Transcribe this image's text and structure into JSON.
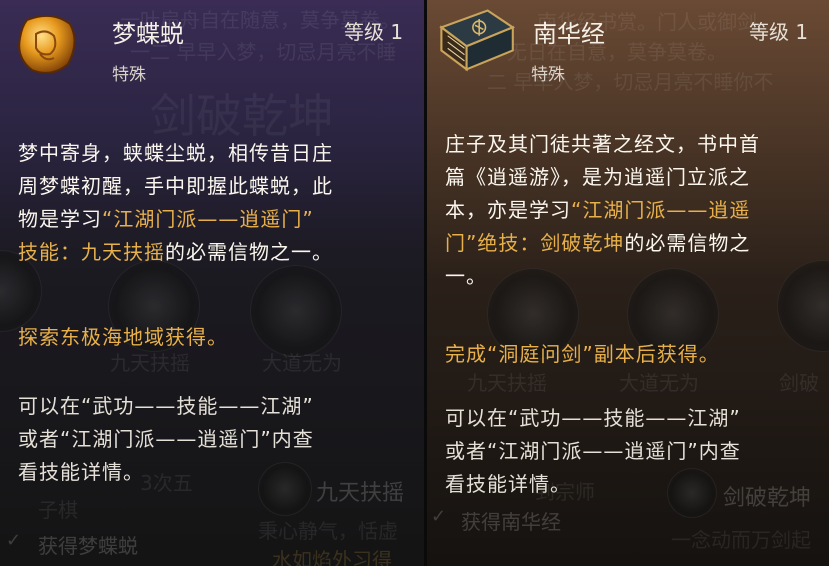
{
  "left": {
    "title": "梦蝶蜕",
    "level": "等级 1",
    "category": "特殊",
    "desc_lines": [
      [
        {
          "t": "梦中寄身，蛱蝶尘蜕，相传昔日庄"
        }
      ],
      [
        {
          "t": "周梦蝶初醒，手中即握此蝶蜕，此"
        }
      ],
      [
        {
          "t": "物是学习"
        },
        {
          "t": "“江湖门派——逍遥门”",
          "h": true
        }
      ],
      [
        {
          "t": "技能：九天扶摇",
          "h": true
        },
        {
          "t": "的必需信物之一。"
        }
      ]
    ],
    "source": "探索东极海地域获得。",
    "hint_lines": [
      "可以在“武功——技能——江湖”",
      "或者“江湖门派——逍遥门”内查",
      "看技能详情。"
    ],
    "bg": {
      "top_text": "一叶扁舟自在随意，莫争莫卷。",
      "top_text2": "一二 早早入梦，切忌月亮不睡",
      "skill1": "九天扶摇",
      "skill2": "大道无为",
      "skill3": "九天扶摇",
      "skill_desc": "秉心静气，恬虚",
      "skill_desc2": "水如焰外习得",
      "check_label": "获得梦蝶蜕",
      "left_note": "3次五",
      "left_note2": "子棋",
      "big": "剑破乾坤"
    }
  },
  "right": {
    "title": "南华经",
    "level": "等级 1",
    "category": "特殊",
    "desc_lines": [
      [
        {
          "t": "庄子及其门徒共著之经文，书中首"
        }
      ],
      [
        {
          "t": "篇《逍遥游》，是为逍遥门立派之"
        }
      ],
      [
        {
          "t": "本，亦是学习"
        },
        {
          "t": "“江湖门派——逍遥",
          "h": true
        }
      ],
      [
        {
          "t": "门”绝技：剑破乾坤",
          "h": true
        },
        {
          "t": "的必需信物之"
        }
      ],
      [
        {
          "t": "一。"
        }
      ]
    ],
    "source": "完成“洞庭问剑”副本后获得。",
    "hint_lines": [
      "可以在“武功——技能——江湖”",
      "或者“江湖门派——逍遥门”内查",
      "看技能详情。"
    ],
    "bg": {
      "top_text": "南华经书赏。门人或御剑",
      "top_text2": "无日在自意，莫争莫卷。",
      "top_text3": "二 早早入梦，切忌月亮不睡你不",
      "skill1": "九天扶摇",
      "skill2": "大道无为",
      "skill3": "剑破乾坤",
      "skill3b": "剑破",
      "skill_desc": "一念动而万剑起",
      "check_label": "获得南华经",
      "note": "到宗师"
    }
  }
}
